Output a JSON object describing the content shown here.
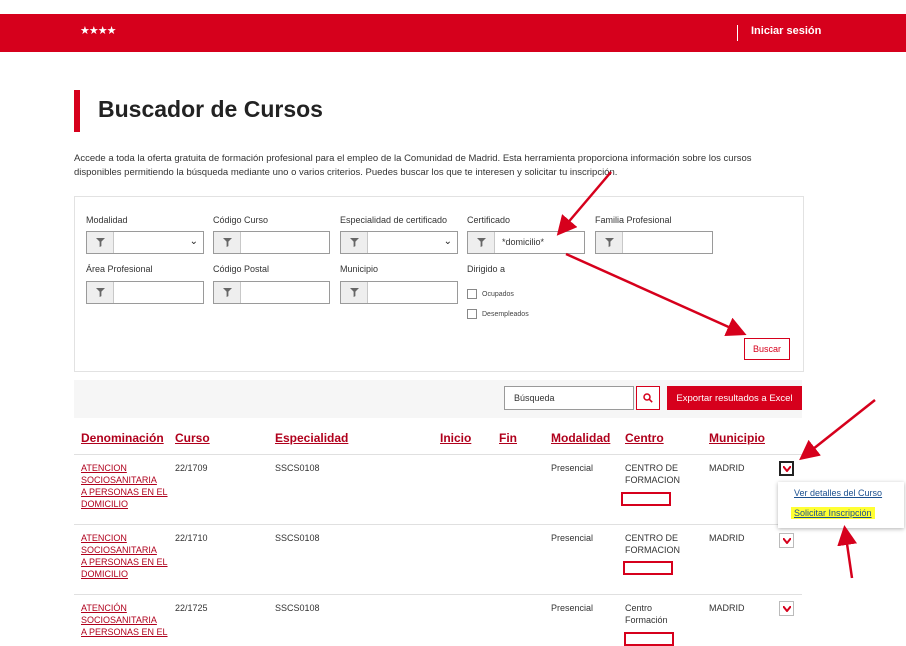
{
  "header": {
    "logo_stars": "★★★★",
    "login_label": "Iniciar sesión"
  },
  "page": {
    "title": "Buscador de Cursos",
    "intro": "Accede a toda la oferta gratuita de formación profesional para el empleo de la Comunidad de Madrid. Esta herramienta proporciona información sobre los cursos disponibles permitiendo la búsqueda mediante uno o varios criterios. Puedes buscar los que te interesen y solicitar tu inscripción."
  },
  "filters": {
    "modalidad": {
      "label": "Modalidad",
      "value": ""
    },
    "codigo_curso": {
      "label": "Código Curso",
      "value": ""
    },
    "especialidad": {
      "label": "Especialidad de certificado",
      "value": ""
    },
    "certificado": {
      "label": "Certificado",
      "value": "*domicilio*"
    },
    "familia": {
      "label": "Familia Profesional",
      "value": ""
    },
    "area": {
      "label": "Área Profesional",
      "value": ""
    },
    "codigo_postal": {
      "label": "Código Postal",
      "value": ""
    },
    "municipio": {
      "label": "Municipio",
      "value": ""
    },
    "dirigido": {
      "label": "Dirigido a",
      "options": [
        "Ocupados",
        "Desempleados"
      ]
    },
    "search_button": "Buscar"
  },
  "results_toolbar": {
    "search_placeholder": "Búsqueda",
    "export_label": "Exportar resultados a Excel"
  },
  "table": {
    "headers": [
      "Denominación",
      "Curso",
      "Especialidad",
      "Inicio",
      "Fin",
      "Modalidad",
      "Centro",
      "Municipio"
    ],
    "rows": [
      {
        "denominacion": [
          "ATENCION",
          "SOCIOSANITARIA",
          "A PERSONAS EN EL",
          "DOMICILIO"
        ],
        "curso": "22/1709",
        "especialidad": "SSCS0108",
        "inicio": "",
        "fin": "",
        "modalidad": "Presencial",
        "centro": [
          "CENTRO DE",
          "FORMACION"
        ],
        "municipio": "MADRID"
      },
      {
        "denominacion": [
          "ATENCION",
          "SOCIOSANITARIA",
          "A PERSONAS EN EL",
          "DOMICILIO"
        ],
        "curso": "22/1710",
        "especialidad": "SSCS0108",
        "inicio": "",
        "fin": "",
        "modalidad": "Presencial",
        "centro": [
          "CENTRO DE",
          "FORMACION"
        ],
        "municipio": "MADRID"
      },
      {
        "denominacion": [
          "ATENCIÓN",
          "SOCIOSANITARIA",
          "A PERSONAS EN EL"
        ],
        "curso": "22/1725",
        "especialidad": "SSCS0108",
        "inicio": "",
        "fin": "",
        "modalidad": "Presencial",
        "centro": [
          "Centro",
          "Formación"
        ],
        "municipio": "MADRID"
      }
    ]
  },
  "row_menu": {
    "items": [
      "Ver detalles del Curso",
      "Solicitar Inscripción"
    ]
  },
  "colors": {
    "brand_red": "#d6001c",
    "link_red": "#b0001c",
    "highlight": "#ffff33",
    "menu_link": "#1a4f8f"
  }
}
